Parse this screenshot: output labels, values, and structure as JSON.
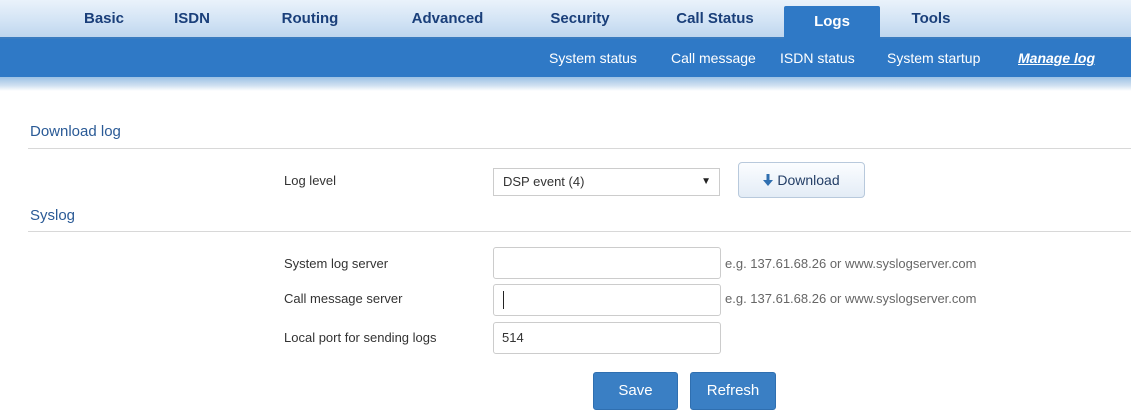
{
  "nav": {
    "tabs": [
      {
        "label": "Basic"
      },
      {
        "label": "ISDN"
      },
      {
        "label": "Routing"
      },
      {
        "label": "Advanced"
      },
      {
        "label": "Security"
      },
      {
        "label": "Call Status"
      },
      {
        "label": "Logs",
        "active": true
      },
      {
        "label": "Tools"
      }
    ],
    "subtabs": [
      {
        "label": "System status"
      },
      {
        "label": "Call message"
      },
      {
        "label": "ISDN status"
      },
      {
        "label": "System startup"
      },
      {
        "label": "Manage log",
        "active": true
      }
    ]
  },
  "download_section": {
    "title": "Download log",
    "log_level_label": "Log level",
    "log_level_value": "DSP event (4)",
    "download_button": "Download"
  },
  "syslog_section": {
    "title": "Syslog",
    "system_log_server_label": "System log server",
    "system_log_server_value": "",
    "system_log_server_hint": "e.g. 137.61.68.26 or www.syslogserver.com",
    "call_message_server_label": "Call message server",
    "call_message_server_value": "",
    "call_message_server_hint": "e.g. 137.61.68.26 or www.syslogserver.com",
    "local_port_label": "Local port for sending logs",
    "local_port_value": "514"
  },
  "actions": {
    "save": "Save",
    "refresh": "Refresh"
  },
  "colors": {
    "nav_active": "#2f79c6",
    "nav_text": "#1a3f7a",
    "section_title": "#2a5a96",
    "button_blue": "#3a7fc4"
  }
}
